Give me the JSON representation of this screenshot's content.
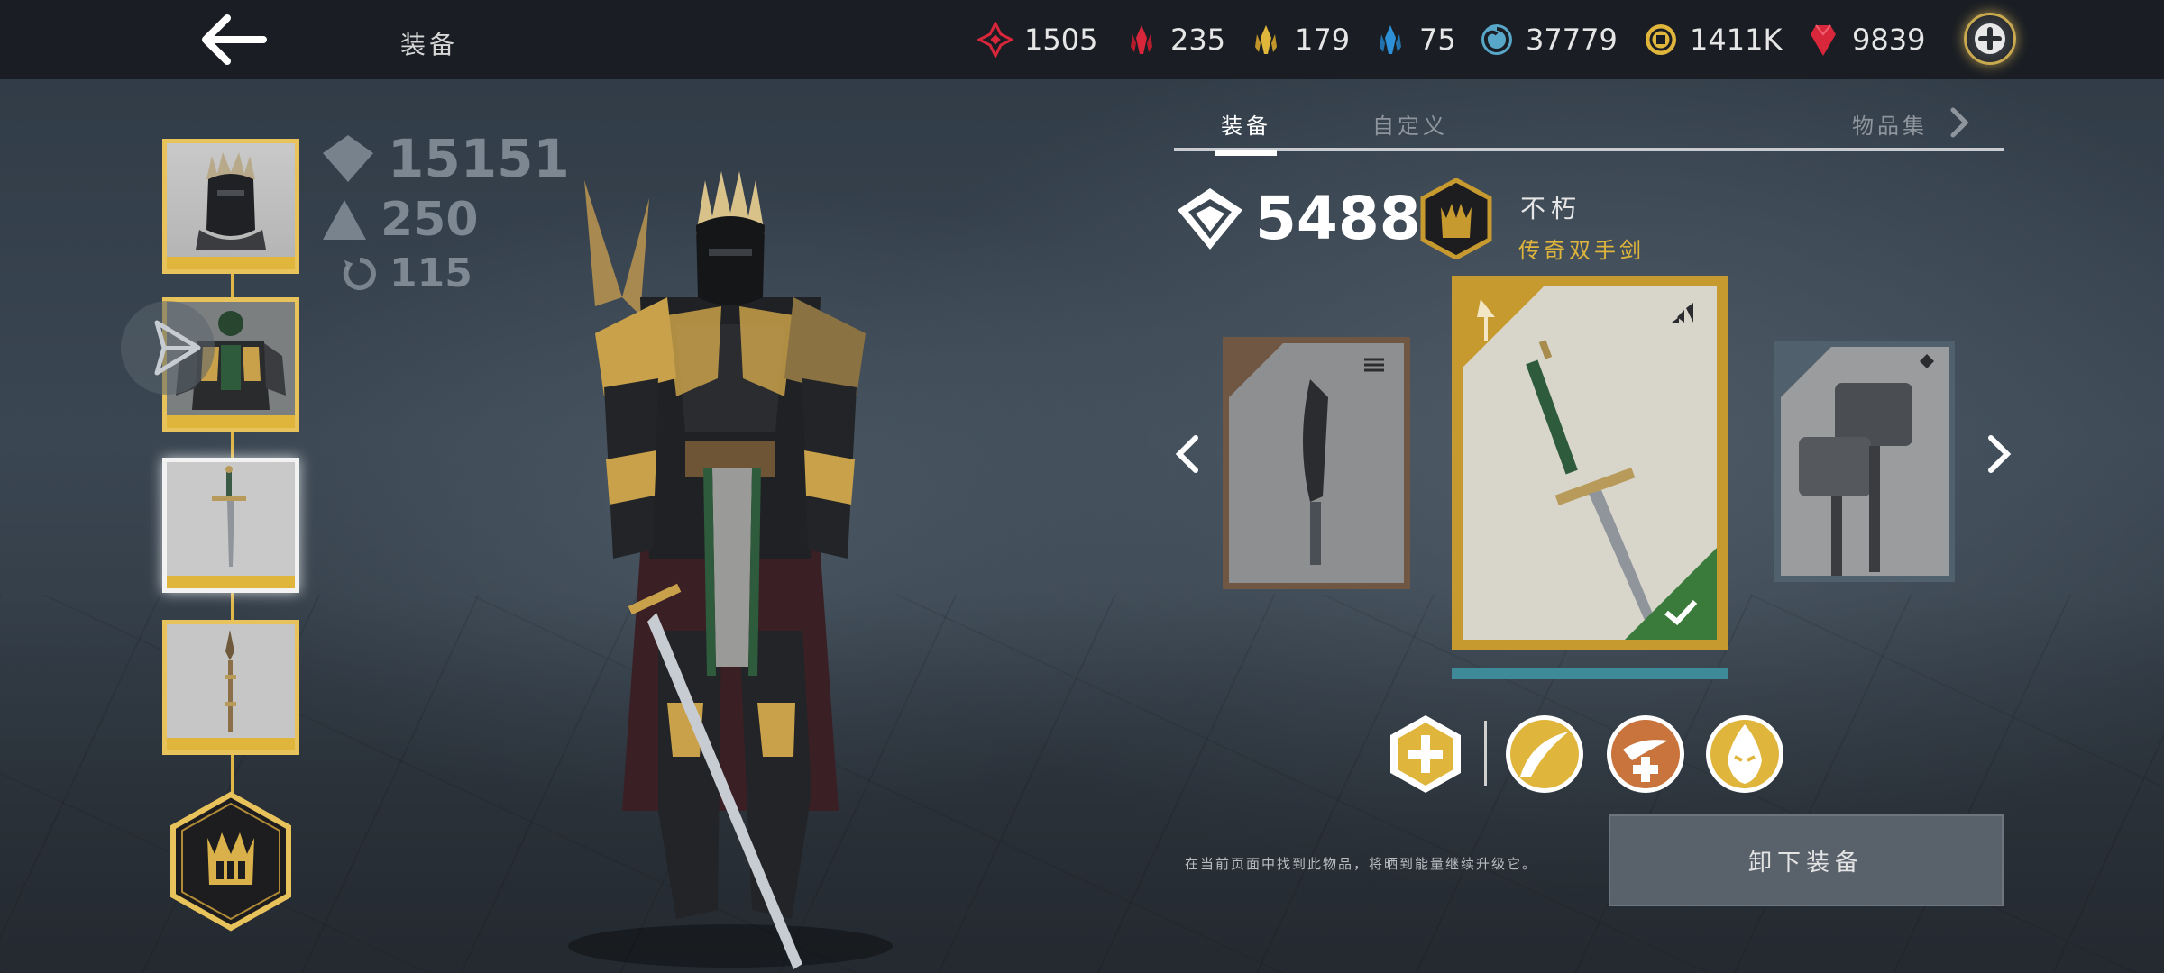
{
  "header": {
    "title": "装备",
    "back_icon": "arrow-left-icon"
  },
  "currencies": [
    {
      "icon": "red-rune-icon",
      "value": "1505",
      "color": "#d8263a"
    },
    {
      "icon": "red-crystal-icon",
      "value": "235",
      "color": "#d8263a"
    },
    {
      "icon": "gold-crystal-icon",
      "value": "179",
      "color": "#e0b53c"
    },
    {
      "icon": "blue-crystal-icon",
      "value": "75",
      "color": "#2e90d6"
    },
    {
      "icon": "energy-swirl-icon",
      "value": "37779",
      "color": "#58a6c8"
    },
    {
      "icon": "gold-coin-icon",
      "value": "1411K",
      "color": "#e0b53c"
    },
    {
      "icon": "ruby-gem-icon",
      "value": "9839",
      "color": "#d8263a"
    }
  ],
  "stats": {
    "power": "15151",
    "level": "250",
    "upgrades": "115"
  },
  "tabs": [
    "装备",
    "自定义",
    "物品集"
  ],
  "item": {
    "power": "5488",
    "name": "不朽",
    "rarity": "传奇双手剑"
  },
  "hint": "在当前页面中找到此物品，将晒到能量继续升级它。",
  "unequip_label": "卸下装备",
  "colors": {
    "gold": "#e0b53c",
    "legendary_rarity": "#e0b53c",
    "topbar": "#1a1e24"
  }
}
